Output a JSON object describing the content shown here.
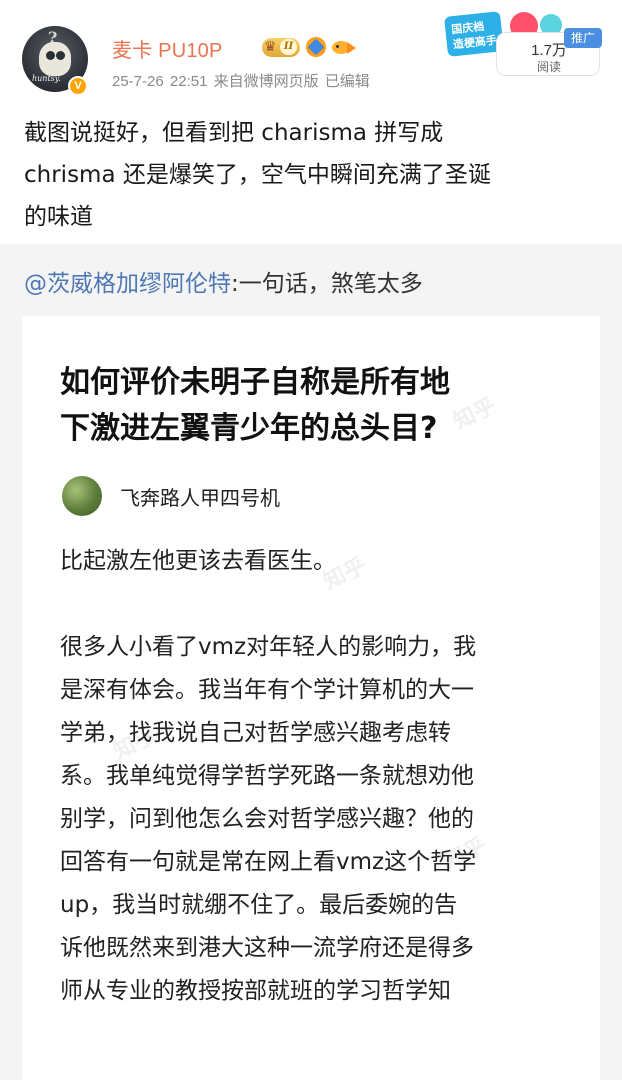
{
  "post": {
    "author_name": "麦卡 PU10P",
    "level_badge": "II",
    "meta": "25-7-26 22:51  来自微博网页版  已编辑",
    "avatar_text": "huntsy.",
    "verified_mark": "V",
    "text_lines": [
      "截图说挺好，但看到把 charisma 拼写成",
      "chrisma 还是爆笑了，空气中瞬间充满了圣诞",
      "的味道"
    ],
    "promo": {
      "line1": "国庆档",
      "line2": "造梗高手",
      "push_label": "推广"
    },
    "reads": {
      "count": "1.7万",
      "label": "阅读"
    }
  },
  "repost": {
    "mention": "@茨威格加缪阿伦特",
    "text": ":一句话，煞笔太多",
    "card": {
      "watermark": "知乎",
      "title_lines": [
        "如何评价未明子自称是所有地",
        "下激进左翼青少年的总头目?"
      ],
      "author": "飞奔路人甲四号机",
      "para1": "比起激左他更该去看医生。",
      "para2_lines": [
        "很多人小看了vmz对年轻人的影响力，我",
        "是深有体会。我当年有个学计算机的大一",
        "学弟，找我说自己对哲学感兴趣考虑转",
        "系。我单纯觉得学哲学死路一条就想劝他",
        "别学，问到他怎么会对哲学感兴趣？他的",
        "回答有一句就是常在网上看vmz这个哲学",
        "up，我当时就绷不住了。最后委婉的告",
        "诉他既然来到港大这种一流学府还是得多",
        "师从专业的教授按部就班的学习哲学知"
      ]
    }
  },
  "colors": {
    "name": "#eb7350",
    "mention": "#4e77b4",
    "meta": "#8a8a8a",
    "repost_bg": "#f4f4f4",
    "push_badge": "#4b8fe2"
  }
}
